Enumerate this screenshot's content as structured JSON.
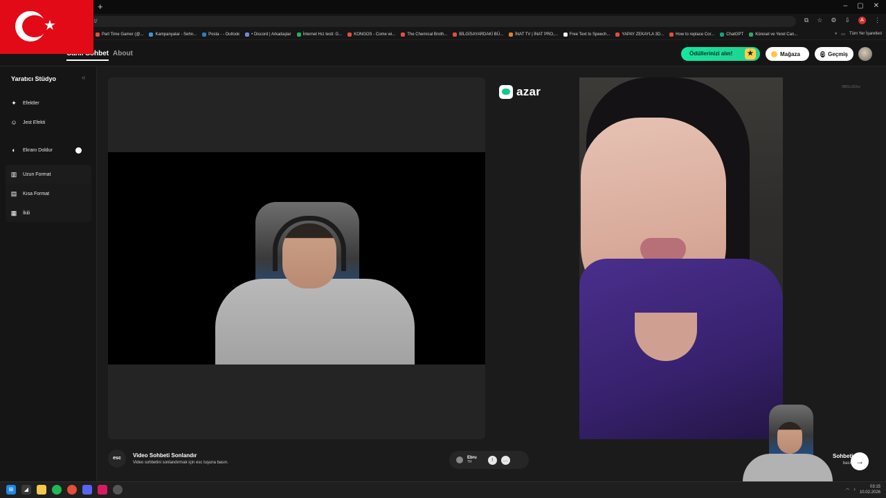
{
  "browser": {
    "url_fragment": "t/",
    "bookmarks": [
      {
        "label": "Part Time Gamer (@...",
        "color": "#e74c3c"
      },
      {
        "label": "Kampanyalar - Sehn...",
        "color": "#3498db"
      },
      {
        "label": "Posta - - Outlook",
        "color": "#2980b9"
      },
      {
        "label": "• Discord | Arkadaşlar",
        "color": "#7289da"
      },
      {
        "label": "İnternet Hız testi: G...",
        "color": "#27ae60"
      },
      {
        "label": "KONGOS - Come wi...",
        "color": "#e74c3c"
      },
      {
        "label": "The Chemical Broth...",
        "color": "#e74c3c"
      },
      {
        "label": "BİLGİSAYARDAKİ BÜ...",
        "color": "#e74c3c"
      },
      {
        "label": "İNAT TV | İNAT PRO,...",
        "color": "#e67e22"
      },
      {
        "label": "Free Text to Speech...",
        "color": "#ecf0f1"
      },
      {
        "label": "YAPAY ZEKAYLA 3D...",
        "color": "#e74c3c"
      },
      {
        "label": "How to replace Cor...",
        "color": "#e74c3c"
      },
      {
        "label": "ChatGPT",
        "color": "#10a37f"
      },
      {
        "label": "Küresel ve Yerel Can...",
        "color": "#27ae60"
      }
    ],
    "bookmarks_more": "»",
    "all_bookmarks": "Tüm Yer İşaretleri",
    "profile_initial": "A"
  },
  "header": {
    "active_tab": "Canlı Sohbet",
    "about_tab": "About",
    "rewards_label": "Ödüllerinizi alın!",
    "store_label": "Mağaza",
    "history_label": "Geçmiş"
  },
  "sidebar": {
    "title": "Yaratıcı Stüdyo",
    "collapse": "«",
    "effects": "Efektler",
    "gesture_effect": "Jest Efekti",
    "fill_screen": "Ekranı Doldur",
    "fill_screen_on": true,
    "formats": {
      "long": "Uzun Format",
      "short": "Kısa Format",
      "dual": "İkili"
    }
  },
  "main": {
    "logo_text": "azar",
    "peer_id": "0f8f1v163vv",
    "end_chat": {
      "key": "esc",
      "title": "Video Sohbeti Sonlandır",
      "subtitle": "Video sohbetini sonlandırmak için esc tuşuna basın."
    },
    "peer": {
      "name": "Ebru",
      "country": "TR"
    },
    "next": {
      "title": "Sohbeti",
      "subtitle": "basın"
    }
  },
  "taskbar": {
    "time": "03:15",
    "date": "10.02.2026"
  }
}
